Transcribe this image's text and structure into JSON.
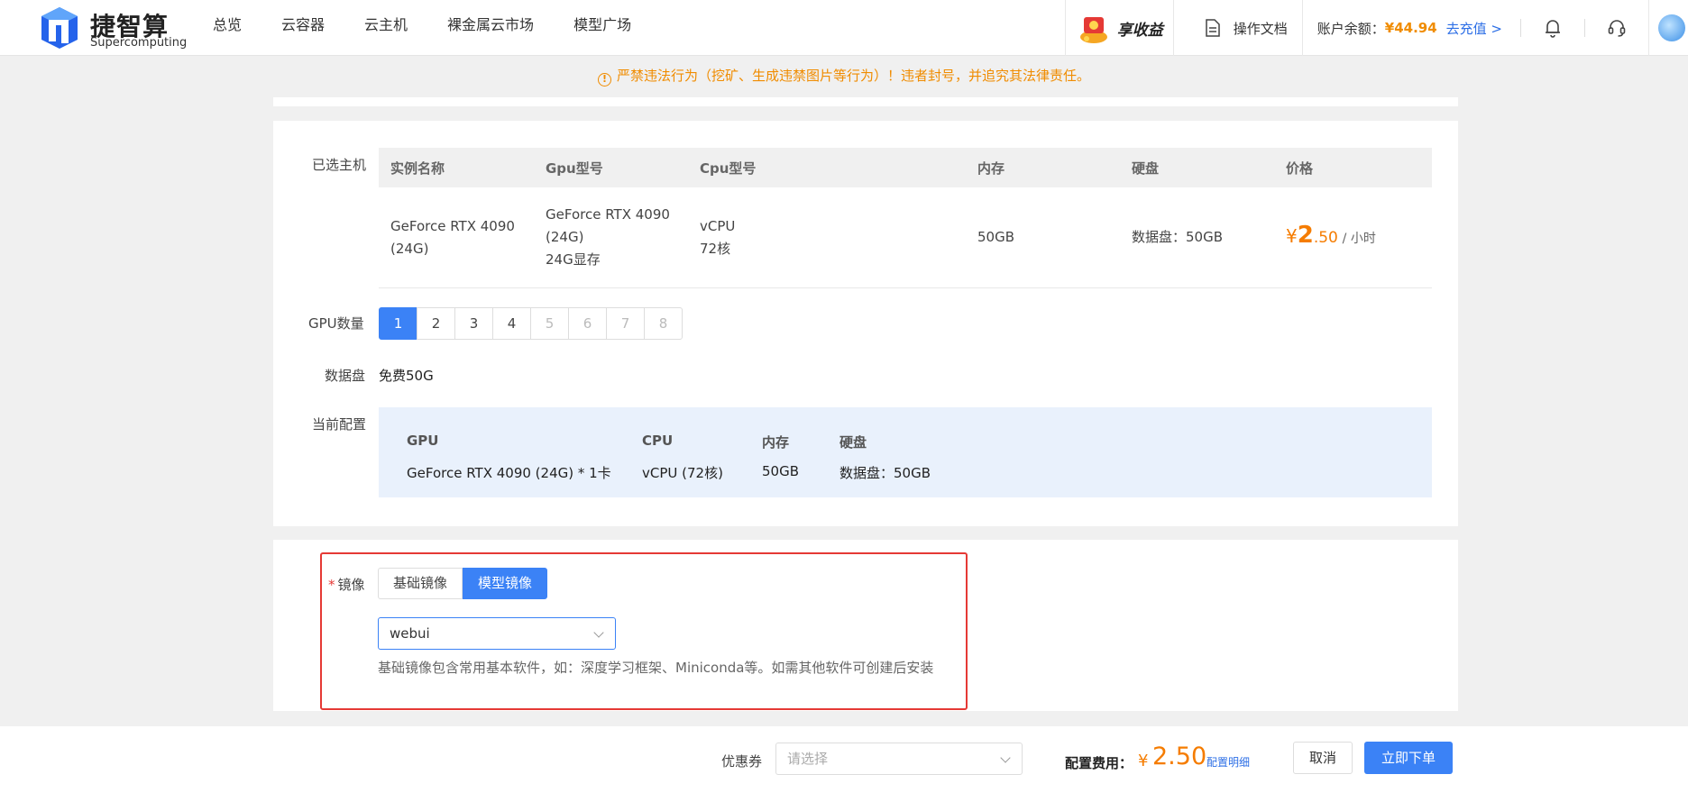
{
  "header": {
    "logo_cn": "捷智算",
    "logo_en": "Supercomputing",
    "nav": [
      "总览",
      "云容器",
      "云主机",
      "裸金属云市场",
      "模型广场"
    ],
    "promo_label": "享收益",
    "docs_label": "操作文档",
    "balance_label": "账户余额：",
    "balance_amount": "¥44.94",
    "recharge_label": "去充值 >"
  },
  "notice": {
    "icon": "info-icon",
    "text": "严禁违法行为（挖矿、生成违禁图片等行为）！违者封号，并追究其法律责任。"
  },
  "selected_host": {
    "label": "已选主机",
    "columns": [
      "实例名称",
      "Gpu型号",
      "Cpu型号",
      "内存",
      "硬盘",
      "价格"
    ],
    "row": {
      "name_line1": "GeForce RTX 4090",
      "name_line2": "(24G)",
      "gpu_line1": "GeForce RTX 4090",
      "gpu_line2": "(24G)",
      "gpu_line3": "24G显存",
      "cpu_line1": "vCPU",
      "cpu_line2": "72核",
      "memory": "50GB",
      "disk": "数据盘：50GB",
      "price_currency": "¥",
      "price_int": "2",
      "price_dec": ".50",
      "price_unit": "/ 小时"
    }
  },
  "gpu_count": {
    "label": "GPU数量",
    "options": [
      "1",
      "2",
      "3",
      "4",
      "5",
      "6",
      "7",
      "8"
    ],
    "selected": "1",
    "enabled_max": 4
  },
  "data_disk": {
    "label": "数据盘",
    "value": "免费50G"
  },
  "current_config": {
    "label": "当前配置",
    "headers": [
      "GPU",
      "CPU",
      "内存",
      "硬盘"
    ],
    "values": [
      "GeForce RTX 4090 (24G) * 1卡",
      "vCPU (72核)",
      "50GB",
      "数据盘：50GB"
    ]
  },
  "image": {
    "required_mark": "*",
    "label": "镜像",
    "tabs": [
      "基础镜像",
      "模型镜像"
    ],
    "active_tab": "模型镜像",
    "selected_value": "webui",
    "hint": "基础镜像包含常用基本软件，如：深度学习框架、Miniconda等。如需其他软件可创建后安装"
  },
  "footer": {
    "coupon_label": "优惠券",
    "coupon_placeholder": "请选择",
    "fee_label": "配置费用：",
    "fee_currency": "¥",
    "fee_value": "2.50",
    "fee_detail": "配置明细",
    "cancel_label": "取消",
    "order_label": "立即下单"
  },
  "colors": {
    "accent": "#3b82f6",
    "price": "#f57c00",
    "warning": "#f08c00",
    "highlight_border": "#e53935"
  }
}
